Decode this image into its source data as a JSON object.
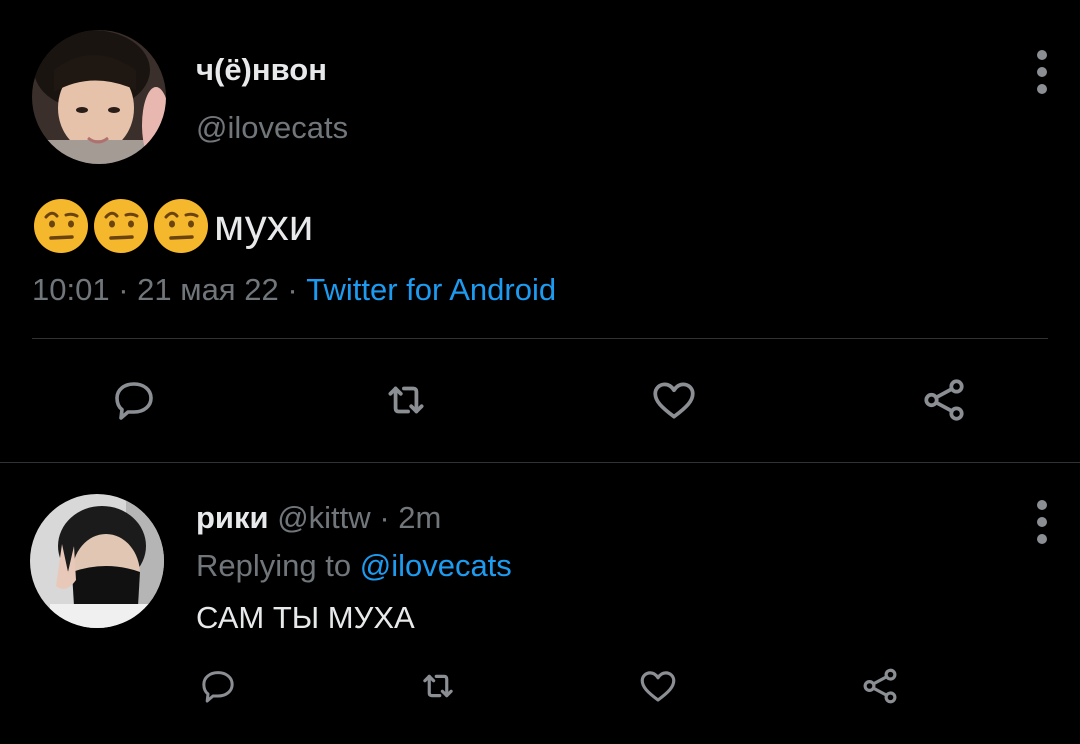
{
  "main_tweet": {
    "author_name": "ч(ё)нвон",
    "author_handle": "@ilovecats",
    "avatar_icon": "user-photo-avatar",
    "emojis": [
      "face-with-raised-eyebrow-emoji",
      "face-with-raised-eyebrow-emoji",
      "face-with-raised-eyebrow-emoji"
    ],
    "text": "мухи",
    "time": "10:01",
    "date": "21 мая 22",
    "separator": "·",
    "source": "Twitter for Android",
    "actions": [
      "reply-icon",
      "retweet-icon",
      "like-icon",
      "share-icon"
    ]
  },
  "reply_tweet": {
    "author_name": "рики",
    "author_handle": "@kittw",
    "separator": "·",
    "time": "2m",
    "replying_label": "Replying to",
    "replying_to": "@ilovecats",
    "text": "САМ ТЫ МУХА",
    "avatar_icon": "user-photo-avatar",
    "actions": [
      "reply-icon",
      "retweet-icon",
      "like-icon",
      "share-icon"
    ]
  },
  "colors": {
    "background": "#000000",
    "primary_text": "#e7e9ea",
    "secondary_text": "#71767b",
    "link": "#1d9bf0",
    "divider": "#2f3336",
    "icon": "#8b8f94"
  }
}
